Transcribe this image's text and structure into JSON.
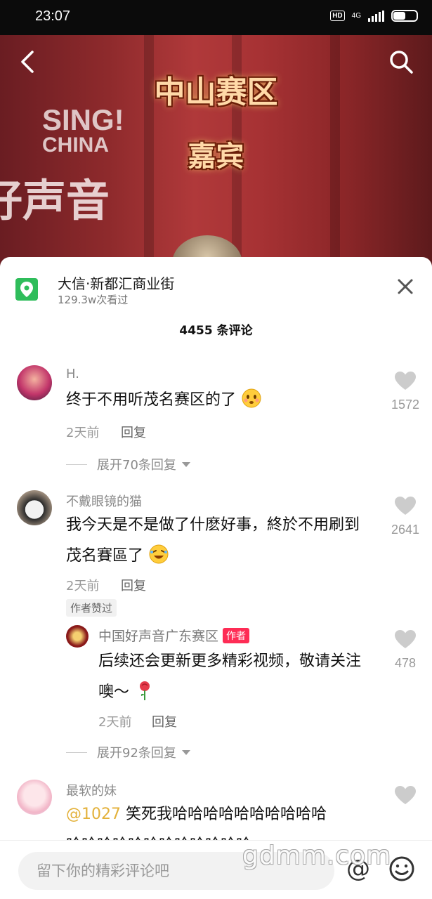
{
  "status_bar": {
    "time": "23:07",
    "hd": "HD",
    "network": "4G",
    "battery": "51"
  },
  "video": {
    "title_line1": "中山赛区",
    "title_line2": "嘉宾",
    "bg_text_en_1": "SING!",
    "bg_text_en_2": "CHINA",
    "bg_text_cn": "好声音"
  },
  "location": {
    "name": "大信·新都汇商业街",
    "views": "129.3w次看过"
  },
  "comments_header": "4455 条评论",
  "comments": [
    {
      "user": "H.",
      "text": "终于不用听茂名赛区的了",
      "time": "2天前",
      "reply_label": "回复",
      "likes": "1572",
      "expand_label": "展开70条回复"
    },
    {
      "user": "不戴眼镜的猫",
      "text_line1": "我今天是不是做了什麽好事，終於不用刷到",
      "text_line2": "茂名賽區了",
      "time": "2天前",
      "reply_label": "回复",
      "likes": "2641",
      "author_liked": "作者赞过",
      "reply": {
        "user": "中国好声音广东赛区",
        "author_tag": "作者",
        "text_line1": "后续还会更新更多精彩视频，敬请关注",
        "text_line2": "噢～",
        "time": "2天前",
        "reply_label": "回复",
        "likes": "478"
      },
      "expand_label": "展开92条回复"
    },
    {
      "user": "最软的妹",
      "mention": "@1027",
      "text": " 笑死我哈哈哈哈哈哈哈哈哈哈",
      "text_line2": "哈哈哈哈哈哈哈哈哈哈哈哈"
    }
  ],
  "input": {
    "placeholder": "留下你的精彩评论吧",
    "at_symbol": "@"
  },
  "watermark": "gdmm.com",
  "colors": {
    "location_green": "#2fbd5b",
    "author_tag_red": "#fe2c55",
    "mention_gold": "#e3b13a"
  }
}
